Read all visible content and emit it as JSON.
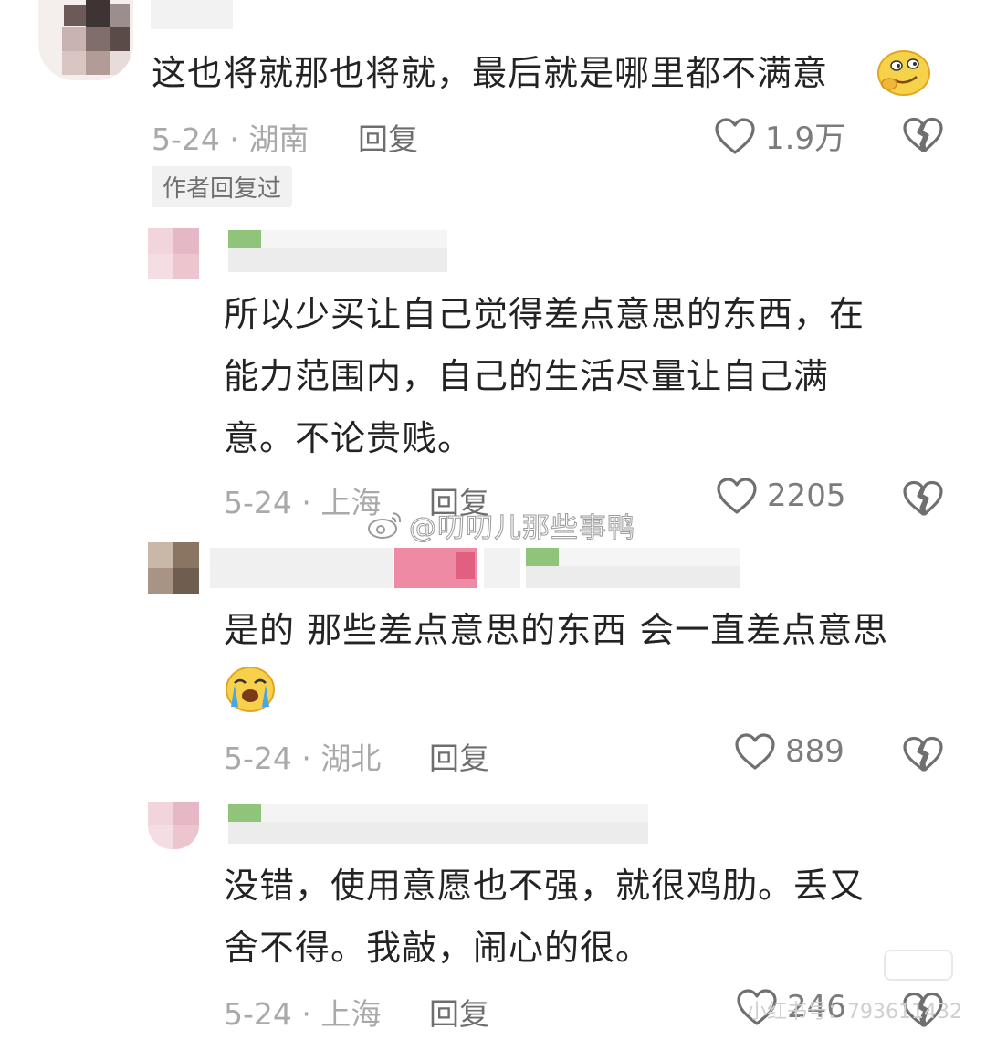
{
  "comments": [
    {
      "text": "这也将就那也将就，最后就是哪里都不满意",
      "date_loc": "5-24 · 湖南",
      "reply": "回复",
      "likes": "1.9万",
      "badge": "作者回复过"
    },
    {
      "lines": [
        "所以少买让自己觉得差点意思的东西，在",
        "能力范围内，自己的生活尽量让自己满",
        "意。不论贵贱。"
      ],
      "date_loc": "5-24 · 上海",
      "reply": "回复",
      "likes": "2205"
    },
    {
      "lines": [
        "是的 那些差点意思的东西 会一直差点意思"
      ],
      "date_loc": "5-24 · 湖北",
      "reply": "回复",
      "likes": "889"
    },
    {
      "lines": [
        "没错，使用意愿也不强，就很鸡肋。丢又",
        "舍不得。我敲，闹心的很。"
      ],
      "date_loc": "5-24 · 上海",
      "reply": "回复",
      "likes": "246"
    }
  ],
  "watermark": "@叨叨儿那些事鸭",
  "watermark_bottom": "小红书号：793611432",
  "icons": {
    "like": "heart-outline-icon",
    "dislike": "broken-heart-icon",
    "weibo": "weibo-logo-icon"
  }
}
